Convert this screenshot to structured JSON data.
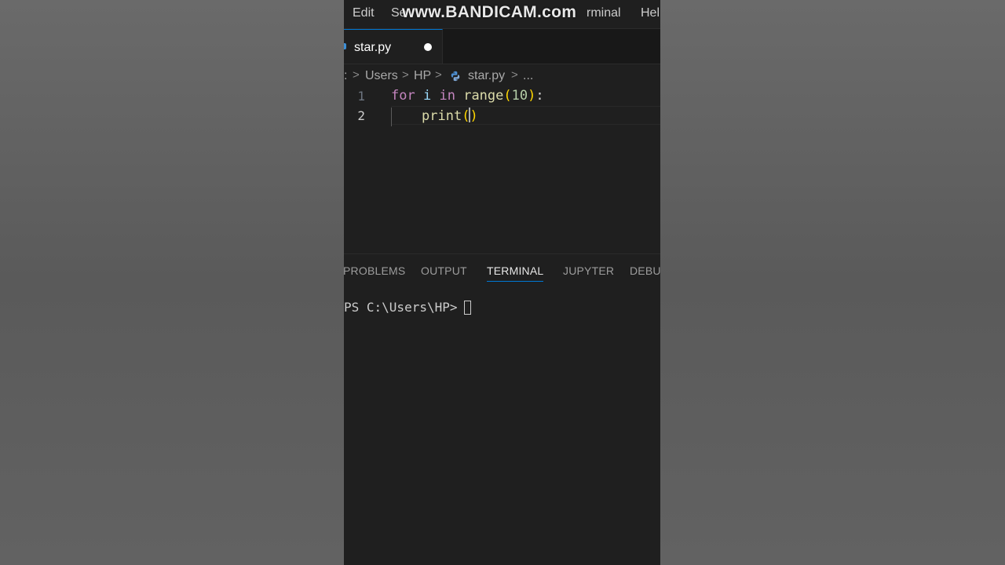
{
  "menubar": {
    "items": [
      "Edit",
      "Se",
      "rminal",
      "Hel"
    ],
    "watermark": "www.BANDICAM.com"
  },
  "tab": {
    "label": "star.py",
    "modified": true
  },
  "breadcrumb": {
    "items": [
      ":",
      "Users",
      "HP",
      "star.py",
      "..."
    ],
    "separator": ">",
    "file_icon": "python-icon"
  },
  "editor": {
    "line_numbers": [
      "1",
      "2"
    ],
    "lines": [
      {
        "tokens": [
          {
            "text": "for",
            "kind": "keyword"
          },
          {
            "text": " ",
            "kind": "plain"
          },
          {
            "text": "i",
            "kind": "var"
          },
          {
            "text": " ",
            "kind": "plain"
          },
          {
            "text": "in",
            "kind": "keyword"
          },
          {
            "text": " ",
            "kind": "plain"
          },
          {
            "text": "range",
            "kind": "func"
          },
          {
            "text": "(",
            "kind": "paren"
          },
          {
            "text": "10",
            "kind": "number"
          },
          {
            "text": ")",
            "kind": "paren"
          },
          {
            "text": ":",
            "kind": "punct"
          }
        ]
      },
      {
        "tokens": [
          {
            "text": "print",
            "kind": "func"
          },
          {
            "text": "(",
            "kind": "paren"
          },
          {
            "text": ")",
            "kind": "paren"
          }
        ]
      }
    ]
  },
  "panel": {
    "tabs": [
      "PROBLEMS",
      "OUTPUT",
      "TERMINAL",
      "JUPYTER",
      "DEBUG"
    ],
    "active_tab": "TERMINAL",
    "terminal_prompt": "PS C:\\Users\\HP>"
  },
  "colors": {
    "accent": "#0078d4",
    "editor_bg": "#1f1f1f",
    "keyword": "#c586c0",
    "function": "#dcdcaa",
    "variable": "#9cdcfe",
    "number": "#b5cea8",
    "bracket": "#ffd700"
  }
}
